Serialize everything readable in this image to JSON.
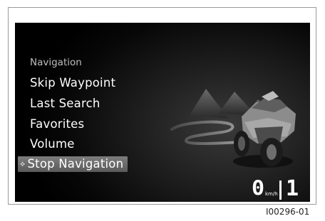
{
  "menu": {
    "heading": "Navigation",
    "items": [
      {
        "label": "Skip Waypoint"
      },
      {
        "label": "Last Search"
      },
      {
        "label": "Favorites"
      },
      {
        "label": "Volume"
      },
      {
        "label": "Stop Navigation",
        "selected": true
      }
    ],
    "selected_icon": "⟡"
  },
  "status": {
    "speed": "0",
    "speed_unit": "km/h",
    "gear": "1"
  },
  "figure_ref": "I00296-01",
  "colors": {
    "screen_bg": "#000000",
    "selection": "#6b6b6b",
    "text": "#ffffff",
    "heading": "#bdbdbd"
  }
}
